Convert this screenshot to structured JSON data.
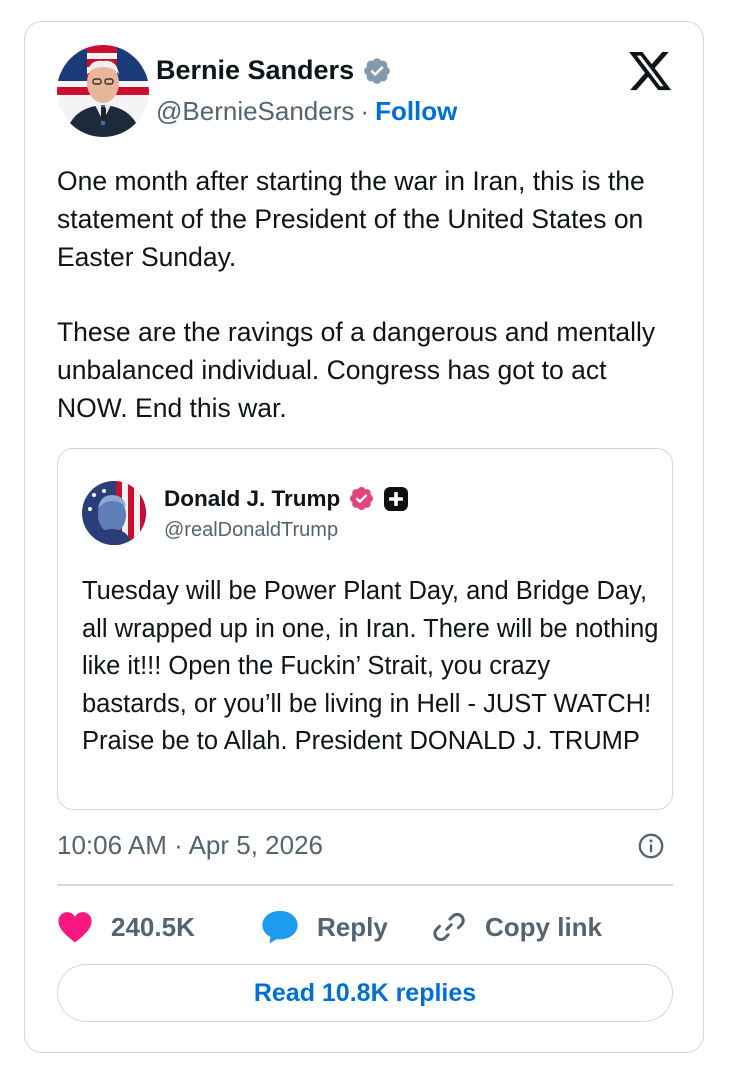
{
  "author": {
    "name": "Bernie Sanders",
    "handle": "@BernieSanders",
    "separator": "·",
    "follow_label": "Follow"
  },
  "brand_icon": "x-logo",
  "tweet": {
    "paragraph1": "One month after starting the war in Iran, this is the statement of the President of the United States on Easter Sunday.",
    "paragraph2": "These are the ravings of a dangerous and mentally unbalanced individual. Congress has got to act NOW. End this war."
  },
  "quoted": {
    "name": "Donald J. Trump",
    "handle": "@realDonaldTrump",
    "text": "Tuesday will be Power Plant Day, and Bridge Day, all wrapped up in one, in Iran. There will be nothing like it!!! Open the Fuckin’ Strait, you crazy bastards, or you’ll be living in Hell - JUST WATCH! Praise be to Allah. President DONALD J. TRUMP"
  },
  "meta": {
    "time": "10:06 AM",
    "separator": "·",
    "date": "Apr 5, 2026"
  },
  "actions": {
    "likes": "240.5K",
    "reply_label": "Reply",
    "copy_label": "Copy link"
  },
  "read_replies_label": "Read 10.8K replies",
  "colors": {
    "link": "#006fd6",
    "like": "#f91880",
    "reply": "#1d9bf0",
    "verified_gray": "#829aab",
    "verified_pink": "#e0457b",
    "border": "#cfd9de",
    "secondary_text": "#536471"
  }
}
